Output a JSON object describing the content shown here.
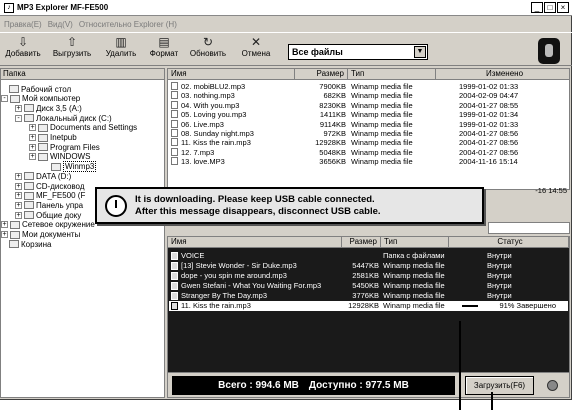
{
  "window": {
    "title": "MP3 Explorer MF-FE500",
    "min": "_",
    "max": "□",
    "close": "×"
  },
  "menu": [
    "Правка(E)",
    "Вид(V)",
    "Относительно Explorer (H)"
  ],
  "toolbar": [
    {
      "label": "Добавить",
      "icon": "add-icon"
    },
    {
      "label": "Выгрузить",
      "icon": "export-icon"
    },
    {
      "label": "Удалить",
      "icon": "delete-icon"
    },
    {
      "label": "Формат",
      "icon": "format-icon"
    },
    {
      "label": "Обновить",
      "icon": "refresh-icon"
    },
    {
      "label": "Отмена",
      "icon": "cancel-icon"
    }
  ],
  "filter": {
    "value": "Все файлы"
  },
  "tree": {
    "header": "Папка",
    "nodes": [
      {
        "label": "Рабочий стол",
        "pm": ""
      },
      {
        "label": "Мой компьютер",
        "pm": "-"
      },
      {
        "label": "Диск 3,5 (A:)",
        "pm": "+"
      },
      {
        "label": "Локальный диск (C:)",
        "pm": "-"
      },
      {
        "label": "Documents and Settings",
        "pm": "+"
      },
      {
        "label": "Inetpub",
        "pm": "+"
      },
      {
        "label": "Program Files",
        "pm": "+"
      },
      {
        "label": "WINDOWS",
        "pm": "+"
      },
      {
        "label": "Winmp3",
        "pm": ""
      },
      {
        "label": "DATA (D:)",
        "pm": "+"
      },
      {
        "label": "CD-дисковод",
        "pm": "+"
      },
      {
        "label": "MF_FE500 (F",
        "pm": "+"
      },
      {
        "label": "Панель упра",
        "pm": "+"
      },
      {
        "label": "Общие доку",
        "pm": "+"
      },
      {
        "label": "Сетевое окружение",
        "pm": "+"
      },
      {
        "label": "Мои документы",
        "pm": "+"
      },
      {
        "label": "Корзина",
        "pm": ""
      }
    ]
  },
  "files": {
    "columns": [
      "Имя",
      "Размер",
      "Тип",
      "Изменено"
    ],
    "rows": [
      {
        "name": "02. mobiBLU2.mp3",
        "size": "7900KB",
        "type": "Winamp media file",
        "modified": "1999-01-02 01:33"
      },
      {
        "name": "03. nothing.mp3",
        "size": "682KB",
        "type": "Winamp media file",
        "modified": "2004-02-09 04:47"
      },
      {
        "name": "04. With you.mp3",
        "size": "8230KB",
        "type": "Winamp media file",
        "modified": "2004-01-27 08:55"
      },
      {
        "name": "05. Loving you.mp3",
        "size": "1411KB",
        "type": "Winamp media file",
        "modified": "1999-01-02 01:34"
      },
      {
        "name": "06. Live.mp3",
        "size": "9114KB",
        "type": "Winamp media file",
        "modified": "1999-01-02 01:33"
      },
      {
        "name": "08. Sunday night.mp3",
        "size": "972KB",
        "type": "Winamp media file",
        "modified": "2004-01-27 08:56"
      },
      {
        "name": "11. Kiss the rain.mp3",
        "size": "12928KB",
        "type": "Winamp media file",
        "modified": "2004-01-27 08:56"
      },
      {
        "name": "12. 7.mp3",
        "size": "5048KB",
        "type": "Winamp media file",
        "modified": "2004-01-27 08:56"
      },
      {
        "name": "13. love.MP3",
        "size": "3656KB",
        "type": "Winamp media file",
        "modified": "2004-11-16 15:14"
      }
    ],
    "partial_dates": [
      "-16 14:55"
    ]
  },
  "popup": {
    "line1": "It is downloading. Please keep USB cable connected.",
    "line2": "After this message disappears, disconnect USB cable."
  },
  "transfer": {
    "columns": [
      "Имя",
      "Размер",
      "Тип",
      "Статус"
    ],
    "rows": [
      {
        "name": "VOICE",
        "size": "",
        "type": "Папка с файлами",
        "status": "Внутри",
        "folder": true
      },
      {
        "name": "[13] Stevie Wonder - Sir Duke.mp3",
        "size": "5447KB",
        "type": "Winamp media file",
        "status": "Внутри"
      },
      {
        "name": "dope - you spin me around.mp3",
        "size": "2581KB",
        "type": "Winamp media file",
        "status": "Внутри"
      },
      {
        "name": "Gwen Stefani - What You Waiting For.mp3",
        "size": "5450KB",
        "type": "Winamp media file",
        "status": "Внутри"
      },
      {
        "name": "Stranger By The Day.mp3",
        "size": "3776KB",
        "type": "Winamp media file",
        "status": "Внутри"
      },
      {
        "name": "11. Kiss the rain.mp3",
        "size": "12928KB",
        "type": "Winamp media file",
        "status": "91% Завершено",
        "selected": true
      }
    ]
  },
  "footer": {
    "total": "Всего : 994.6 MB",
    "available": "Доступно : 977.5 MB",
    "upload_label": "Загрузить(F6)"
  }
}
